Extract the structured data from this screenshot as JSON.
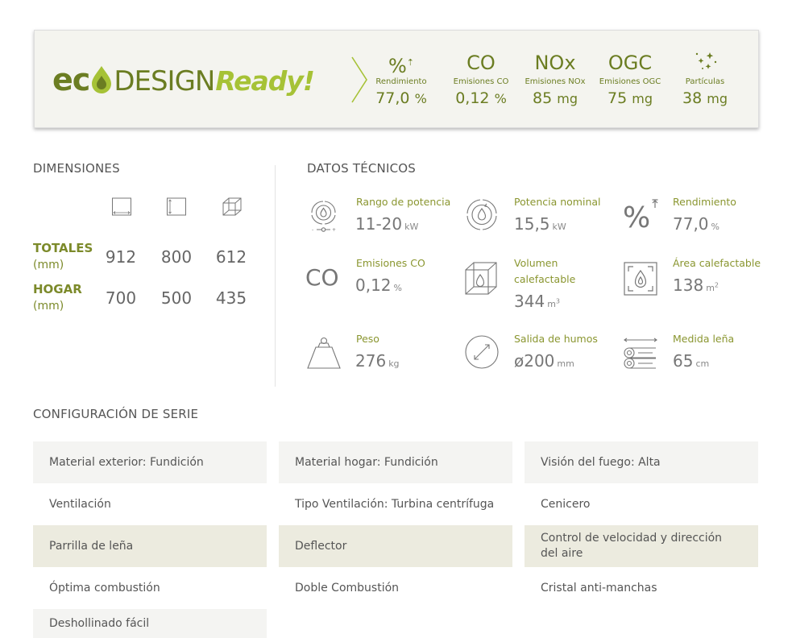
{
  "eco_banner": {
    "logo": {
      "eco": "ec",
      "design": "DESIGN",
      "ready": "Ready!"
    },
    "metrics": [
      {
        "symbol": "%",
        "label": "Rendimiento",
        "value": "77,0",
        "unit": "%"
      },
      {
        "symbol": "CO",
        "label": "Emisiones CO",
        "value": "0,12",
        "unit": "%"
      },
      {
        "symbol": "NOx",
        "label": "Emisiones NOx",
        "value": "85",
        "unit": "mg"
      },
      {
        "symbol": "OGC",
        "label": "Emisiones OGC",
        "value": "75",
        "unit": "mg"
      },
      {
        "symbol": "sparkles-icon",
        "label": "Partículas",
        "value": "38",
        "unit": "mg"
      }
    ]
  },
  "dimensions": {
    "title": "DIMENSIONES",
    "rows": [
      {
        "label": "TOTALES",
        "unit": "(mm)",
        "values": [
          "912",
          "800",
          "612"
        ]
      },
      {
        "label": "HOGAR",
        "unit": "(mm)",
        "values": [
          "700",
          "500",
          "435"
        ]
      }
    ]
  },
  "tech": {
    "title": "DATOS TÉCNICOS",
    "items": [
      {
        "icon": "power-range-icon",
        "label": "Rango de potencia",
        "value": "11-20",
        "unit": "kW"
      },
      {
        "icon": "nominal-power-icon",
        "label": "Potencia nominal",
        "value": "15,5",
        "unit": "kW"
      },
      {
        "icon": "efficiency-icon",
        "label": "Rendimiento",
        "value": "77,0",
        "unit": "%"
      },
      {
        "icon": "co-icon",
        "label": "Emisiones CO",
        "value": "0,12",
        "unit": "%"
      },
      {
        "icon": "volume-icon",
        "label": "Volumen calefactable",
        "value": "344",
        "unit": "m",
        "unit_sup": "3"
      },
      {
        "icon": "heated-area-icon",
        "label": "Área calefactable",
        "value": "138",
        "unit": "m",
        "unit_sup": "2"
      },
      {
        "icon": "weight-icon",
        "label": "Peso",
        "value": "276",
        "unit": "kg"
      },
      {
        "icon": "flue-outlet-icon",
        "label": "Salida de humos",
        "value": "ø200",
        "unit": "mm"
      },
      {
        "icon": "log-length-icon",
        "label": "Medida leña",
        "value": "65",
        "unit": "cm"
      }
    ],
    "co_symbol": "CO"
  },
  "config": {
    "title": "CONFIGURACIÓN DE SERIE",
    "items": [
      "Material exterior: Fundición",
      "Material hogar: Fundición",
      "Visión del fuego: Alta",
      "Ventilación",
      "Tipo Ventilación: Turbina centrífuga",
      "Cenicero",
      "Parrilla de leña",
      "Deflector",
      "Control de velocidad y dirección del aire",
      "Óptima combustión",
      "Doble Combustión",
      "Cristal anti-manchas",
      "Deshollinado fácil"
    ]
  },
  "colors": {
    "olive": "#6b7d22",
    "lime": "#a6c236",
    "label_green": "#8a9630",
    "row_grey": "#f4f4f2",
    "row_olive": "#ecebdf"
  }
}
